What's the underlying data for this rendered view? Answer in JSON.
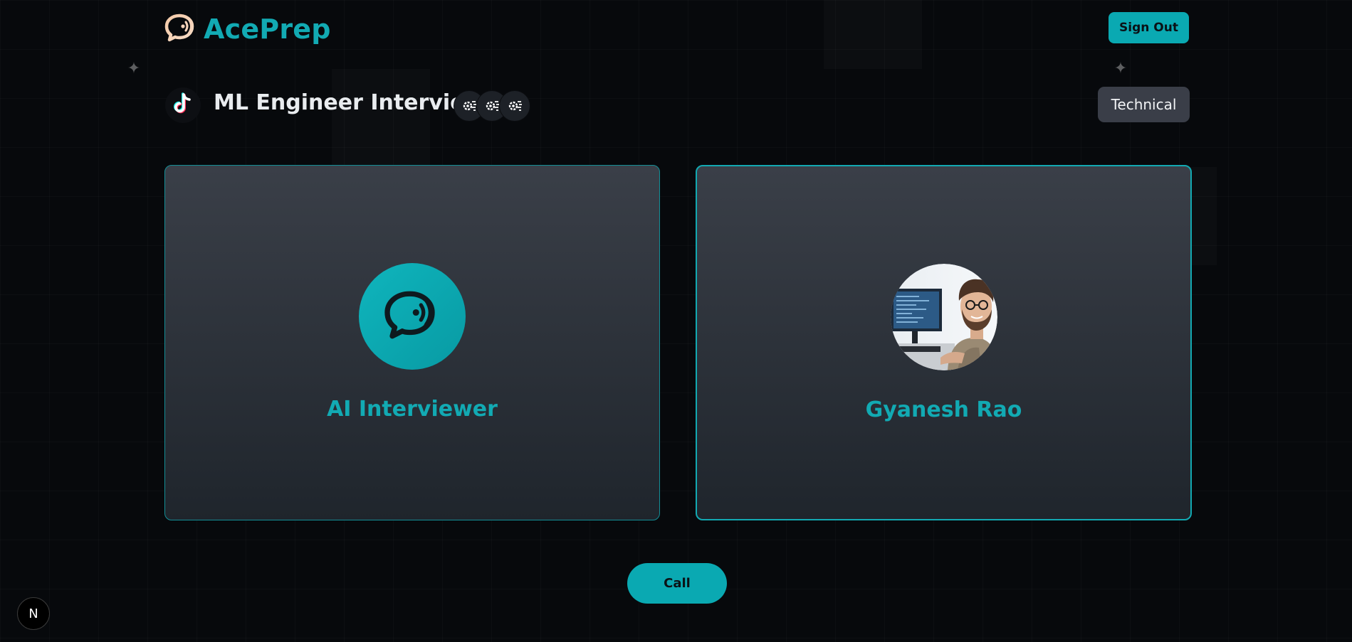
{
  "brand": {
    "name": "AcePrep"
  },
  "header": {
    "sign_out_label": "Sign Out"
  },
  "interview": {
    "title": "ML Engineer Interview",
    "type": "Technical",
    "company_icon": "tiktok-icon",
    "tech_icons": [
      "tech-icon",
      "tech-icon",
      "tech-icon"
    ]
  },
  "participants": {
    "ai": {
      "name": "AI Interviewer",
      "icon": "chat-wave-icon"
    },
    "user": {
      "name": "Gyanesh Rao"
    }
  },
  "actions": {
    "call_label": "Call"
  },
  "dev_badge": {
    "label": "N"
  },
  "colors": {
    "accent": "#0aa9b2",
    "background": "#07090c",
    "card_top": "#3a3f48",
    "card_bottom": "#1f252c",
    "badge": "#3a3e48"
  }
}
